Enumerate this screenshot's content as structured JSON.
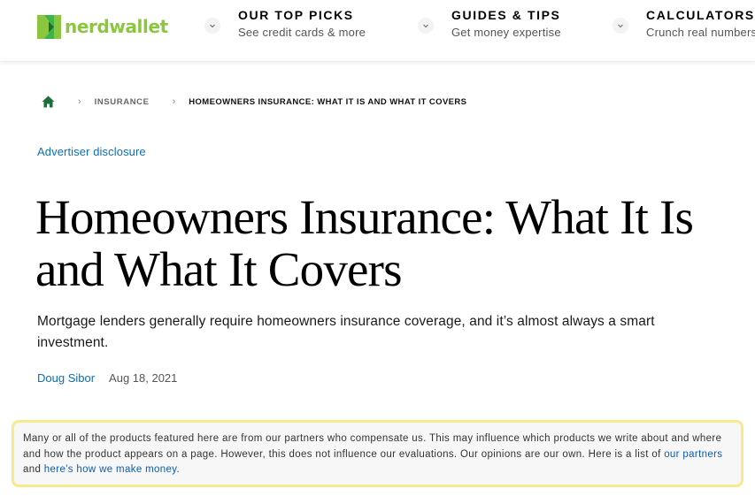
{
  "brand": {
    "name": "nerdwallet",
    "colors": {
      "logo_green": "#8cc63f",
      "logo_dark_green": "#2e8540",
      "link_blue": "#0a6ebd",
      "disclaimer_border": "#f9e98a",
      "home_icon": "#1f6d3a"
    }
  },
  "nav": {
    "items": [
      {
        "title": "OUR TOP PICKS",
        "subtitle": "See credit cards & more",
        "icon": "chevron-down-icon"
      },
      {
        "title": "GUIDES & TIPS",
        "subtitle": "Get money expertise",
        "icon": "chevron-down-icon"
      },
      {
        "title": "CALCULATORS",
        "subtitle": "Crunch real numbers",
        "icon": "chevron-down-icon"
      }
    ]
  },
  "breadcrumb": {
    "home_icon": "home-icon",
    "separator": "›",
    "items": [
      {
        "label": "INSURANCE"
      },
      {
        "label": "HOMEOWNERS INSURANCE: WHAT IT IS AND WHAT IT COVERS"
      }
    ]
  },
  "article": {
    "advertiser_disclosure": "Advertiser disclosure",
    "title": "Homeowners Insurance: What It Is and What It Covers",
    "subtitle": "Mortgage lenders generally require homeowners insurance coverage, and it’s almost always a smart investment.",
    "author": "Doug Sibor",
    "date": "Aug 18, 2021"
  },
  "disclaimer": {
    "text": "Many or all of the products featured here are from our partners who compensate us. This may influence which products we write about and where and how the product appears on a page. However, this does not influence our evaluations. Our opinions are our own. Here is a list of ",
    "link1": "our partners",
    "middle": " and ",
    "link2": "here's how we make money",
    "end": "."
  }
}
